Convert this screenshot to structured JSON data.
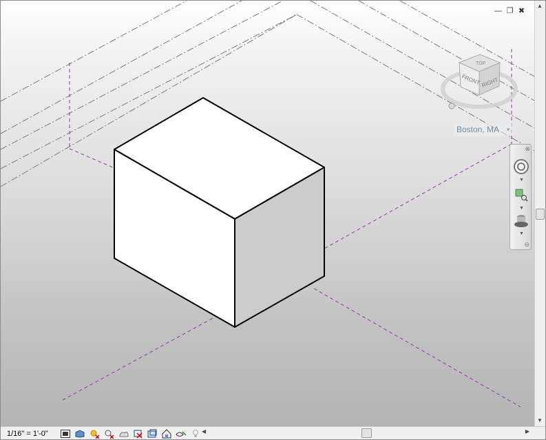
{
  "window": {
    "controls": {
      "minimize": "—",
      "restore": "❐",
      "close": "✖"
    }
  },
  "viewcube": {
    "faces": {
      "top": "TOP",
      "front": "FRONT",
      "right": "RIGHT"
    },
    "location": "Boston, MA"
  },
  "status_bar": {
    "scale": "1/16\" = 1'-0\"",
    "icons": [
      "detail-level-icon",
      "visual-style-icon",
      "sun-path-icon",
      "shadows-icon",
      "render-icon",
      "crop-view-icon",
      "show-crop-icon",
      "temporary-hide-icon",
      "reveal-hidden-icon",
      "analysis-display-icon",
      "highlight-icon"
    ]
  },
  "colors": {
    "box_top": "#ffffff",
    "box_left": "#ffffff",
    "box_right": "#cccccc",
    "grid_line": "#7a7a7a",
    "level_line": "#8a3a9a"
  }
}
